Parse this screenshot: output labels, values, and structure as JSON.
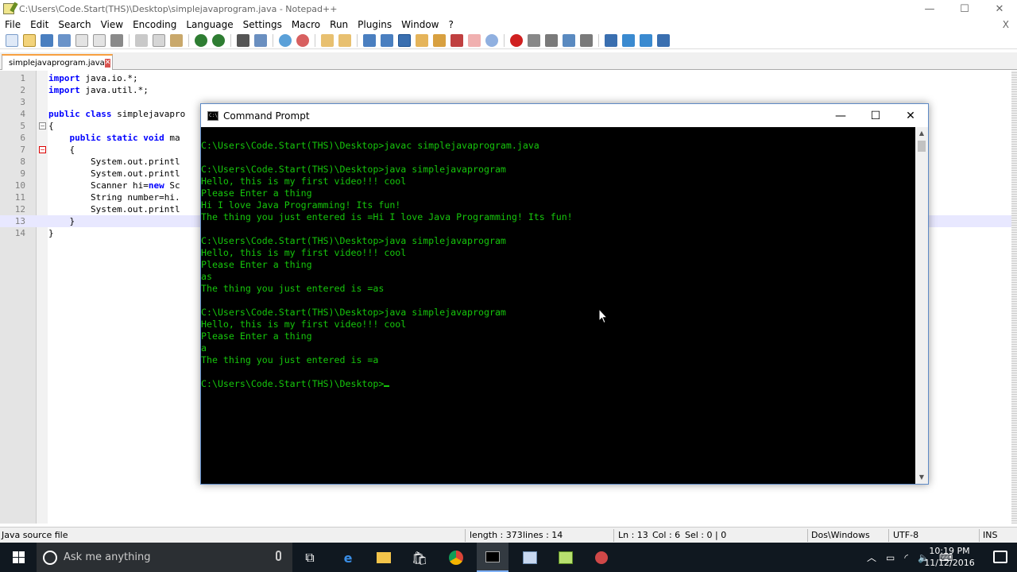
{
  "notepad": {
    "title": "C:\\Users\\Code.Start(THS)\\Desktop\\simplejavaprogram.java - Notepad++",
    "window_controls": {
      "minimize": "—",
      "maximize": "☐",
      "close": "✕"
    },
    "menu": [
      "File",
      "Edit",
      "Search",
      "View",
      "Encoding",
      "Language",
      "Settings",
      "Macro",
      "Run",
      "Plugins",
      "Window",
      "?"
    ],
    "menu_close": "X",
    "tab_label": "simplejavaprogram.java",
    "tab_close": "✕",
    "lines": [
      {
        "n": "1",
        "code": "import java.io.*;"
      },
      {
        "n": "2",
        "code": "import java.util.*;"
      },
      {
        "n": "3",
        "code": ""
      },
      {
        "n": "4",
        "code": "public class simplejavapro"
      },
      {
        "n": "5",
        "code": "{"
      },
      {
        "n": "6",
        "code": "    public static void ma"
      },
      {
        "n": "7",
        "code": "    {"
      },
      {
        "n": "8",
        "code": "        System.out.printl"
      },
      {
        "n": "9",
        "code": "        System.out.printl"
      },
      {
        "n": "10",
        "code": "        Scanner hi=new Sc"
      },
      {
        "n": "11",
        "code": "        String number=hi."
      },
      {
        "n": "12",
        "code": "        System.out.printl"
      },
      {
        "n": "13",
        "code": "    }"
      },
      {
        "n": "14",
        "code": "}"
      }
    ],
    "status": {
      "file_type": "Java source file",
      "length": "length : 373",
      "lines": "lines : 14",
      "ln": "Ln : 13",
      "col": "Col : 6",
      "sel": "Sel : 0 | 0",
      "eol": "Dos\\Windows",
      "encoding": "UTF-8",
      "mode": "INS"
    }
  },
  "cmd": {
    "title": "Command Prompt",
    "icon_text": "C:\\",
    "window_controls": {
      "minimize": "—",
      "maximize": "☐",
      "close": "✕"
    },
    "lines": [
      "C:\\Users\\Code.Start(THS)\\Desktop>javac simplejavaprogram.java",
      "",
      "C:\\Users\\Code.Start(THS)\\Desktop>java simplejavaprogram",
      "Hello, this is my first video!!! cool",
      "Please Enter a thing",
      "Hi I love Java Programming! Its fun!",
      "The thing you just entered is =Hi I love Java Programming! Its fun!",
      "",
      "C:\\Users\\Code.Start(THS)\\Desktop>java simplejavaprogram",
      "Hello, this is my first video!!! cool",
      "Please Enter a thing",
      "as",
      "The thing you just entered is =as",
      "",
      "C:\\Users\\Code.Start(THS)\\Desktop>java simplejavaprogram",
      "Hello, this is my first video!!! cool",
      "Please Enter a thing",
      "a",
      "The thing you just entered is =a",
      ""
    ],
    "prompt": "C:\\Users\\Code.Start(THS)\\Desktop>"
  },
  "taskbar": {
    "search_placeholder": "Ask me anything",
    "time": "10:19 PM",
    "date": "11/12/2016"
  }
}
